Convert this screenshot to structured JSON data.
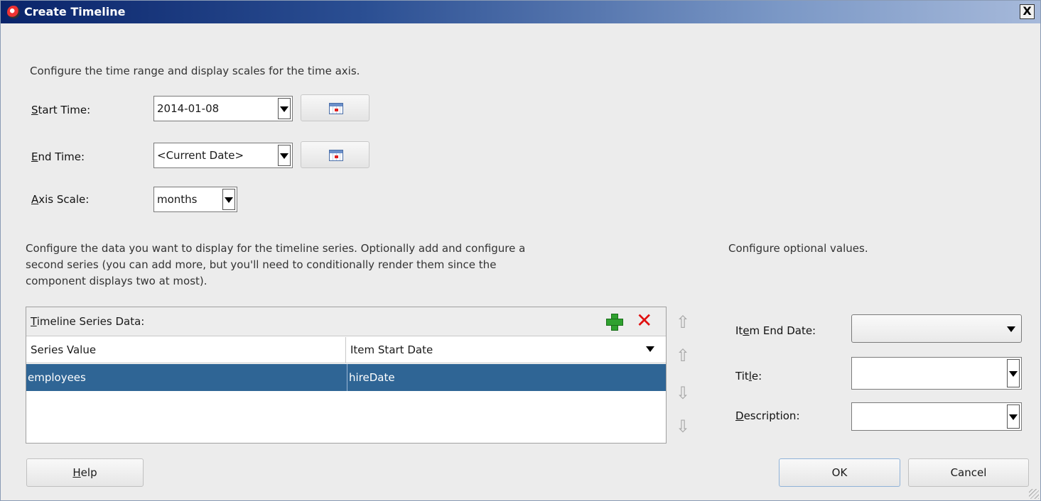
{
  "window": {
    "title": "Create Timeline",
    "close_label": "X"
  },
  "time_axis": {
    "intro": "Configure the time range and display scales for the time axis.",
    "start_time": {
      "label_mnemonic": "S",
      "label_rest": "tart Time:",
      "value": "2014-01-08"
    },
    "end_time": {
      "label_mnemonic": "E",
      "label_rest": "nd Time:",
      "value": "<Current Date>"
    },
    "axis_scale": {
      "label_mnemonic": "A",
      "label_rest": "xis Scale:",
      "value": "months"
    }
  },
  "series_section": {
    "intro_lines": [
      "Configure the data you want to display for the timeline series. Optionally add and configure a",
      "second series (you can add more, but you'll need to conditionally render them since the",
      "component displays two at most)."
    ],
    "table_title_mnemonic": "T",
    "table_title_rest": "imeline Series Data:",
    "columns": [
      "Series Value",
      "Item Start Date"
    ],
    "rows": [
      {
        "series_value": "employees",
        "item_start_date": "hireDate"
      }
    ]
  },
  "optional_section": {
    "intro": "Configure optional values.",
    "item_end_date": {
      "label_pre": "It",
      "label_mnemonic": "e",
      "label_rest": "m End Date:",
      "value": ""
    },
    "title": {
      "label_pre": "Tit",
      "label_mnemonic": "l",
      "label_rest": "e:",
      "value": ""
    },
    "description": {
      "label_pre": "",
      "label_mnemonic": "D",
      "label_rest": "escription:",
      "value": ""
    }
  },
  "buttons": {
    "help_mnemonic": "H",
    "help_rest": "elp",
    "ok": "OK",
    "cancel": "Cancel"
  },
  "icons": {
    "add": "plus-icon",
    "remove": "x-icon",
    "calendar": "calendar-icon",
    "move_top": "arrow-top-icon",
    "move_up": "arrow-up-icon",
    "move_down": "arrow-down-icon",
    "move_bottom": "arrow-bottom-icon"
  }
}
